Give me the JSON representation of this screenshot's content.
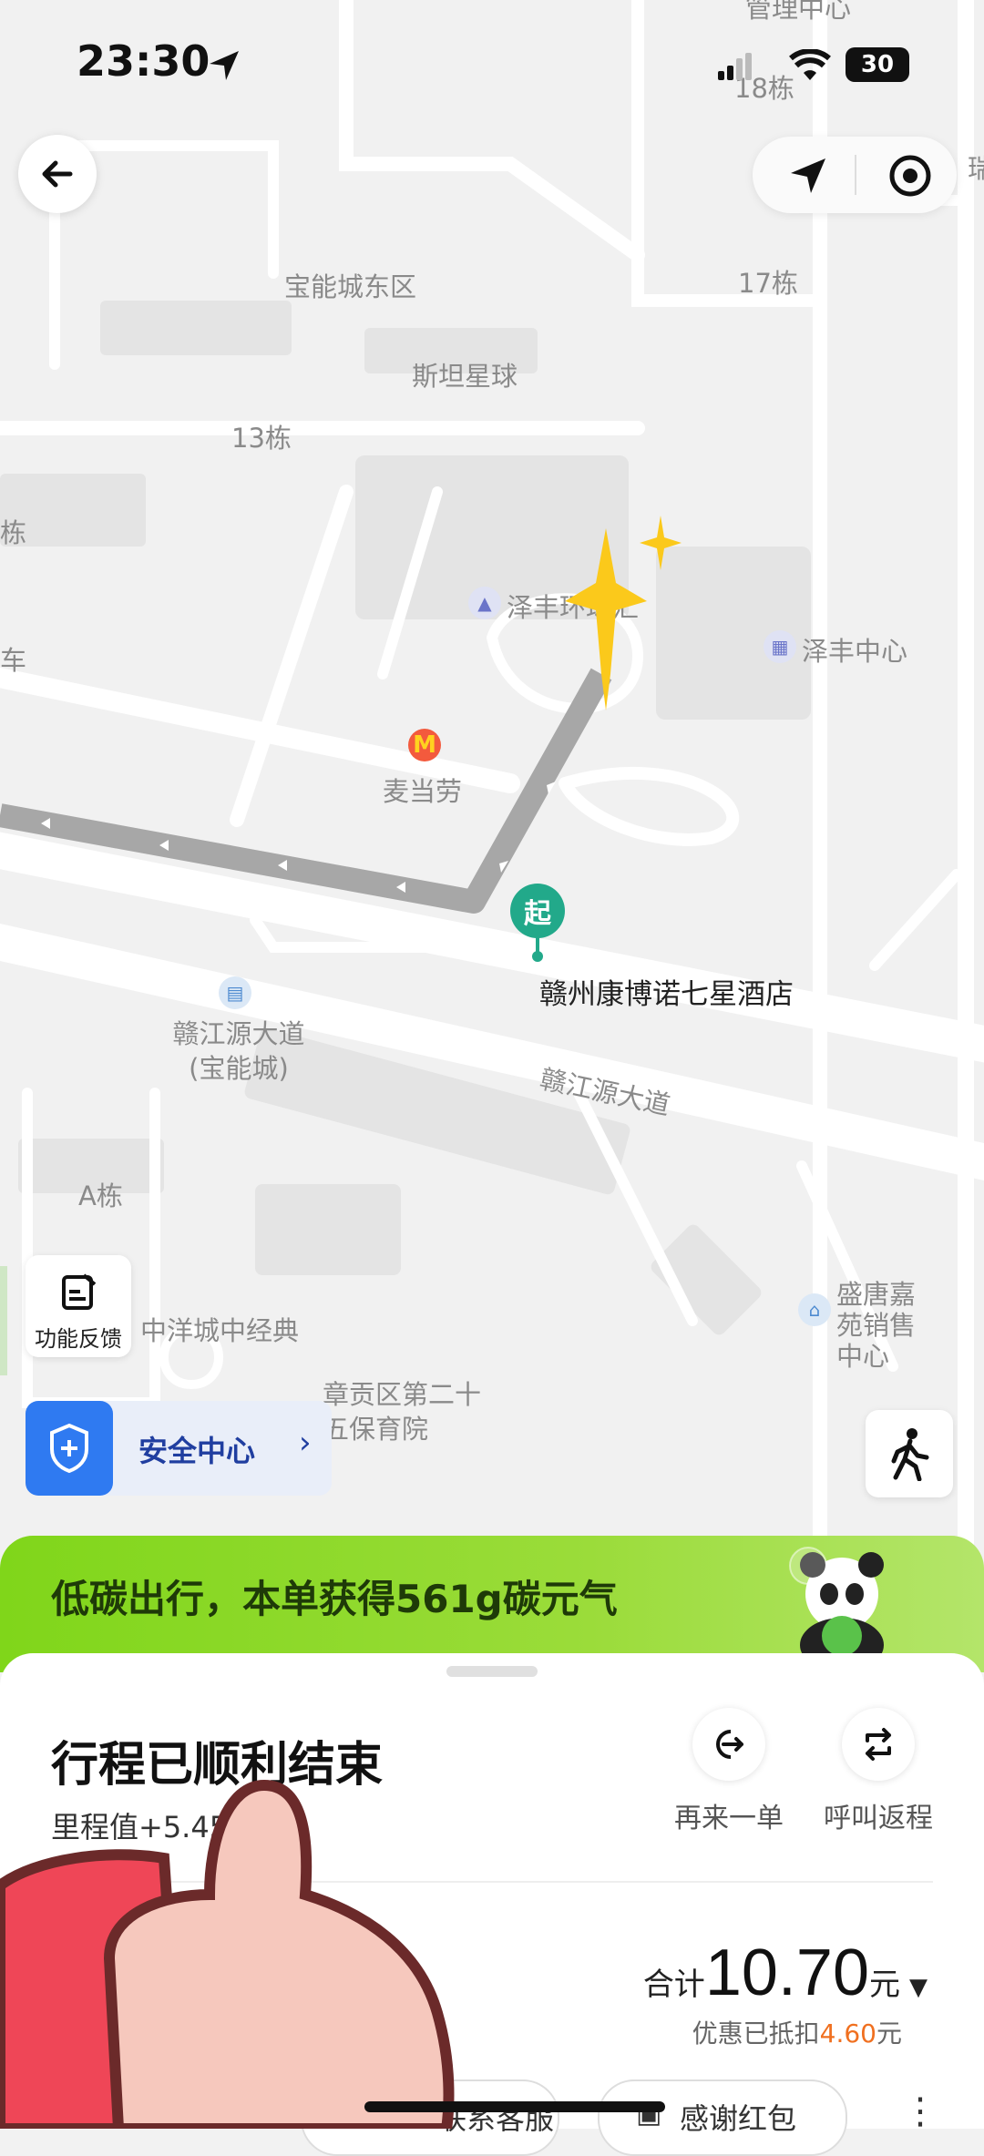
{
  "status_bar": {
    "time": "23:30",
    "battery": "30"
  },
  "map": {
    "labels": {
      "admin_center": "管理中心",
      "b18": "18栋",
      "baoneng_east": "宝能城东区",
      "b17": "17栋",
      "stanford": "斯坦星球",
      "b13": "13栋",
      "zefeng_mall": "泽丰环球汇",
      "zefeng_center": "泽丰中心",
      "mcdonalds": "麦当劳",
      "hotel": "赣州康博诺七星酒店",
      "bus_stop": "赣江源大道(宝能城)",
      "road": "赣江源大道",
      "block_a": "A栋",
      "zhongyang": "中洋城中经典",
      "kindergarten": "章贡区第二十五保育院",
      "shengtang": "盛唐嘉苑销售中心",
      "side_building": "栋",
      "side_car": "车",
      "edge_char": "瑞"
    },
    "start_marker": "起"
  },
  "feedback": {
    "label": "功能反馈"
  },
  "safety_center": {
    "label": "安全中心"
  },
  "banner": {
    "text": "低碳出行，本单获得561g碳元气"
  },
  "trip": {
    "title": "行程已顺利结束",
    "mileage": "里程值+5.45",
    "actions": [
      {
        "label": "再来一单"
      },
      {
        "label": "呼叫返程"
      }
    ],
    "total_prefix": "合计",
    "total_amount": "10.70",
    "total_unit": "元",
    "discount_prefix": "优惠已抵扣",
    "discount_amount": "4.60",
    "discount_unit": "元",
    "buttons": {
      "contact": "联系客服",
      "thanks": "感谢红包"
    }
  }
}
